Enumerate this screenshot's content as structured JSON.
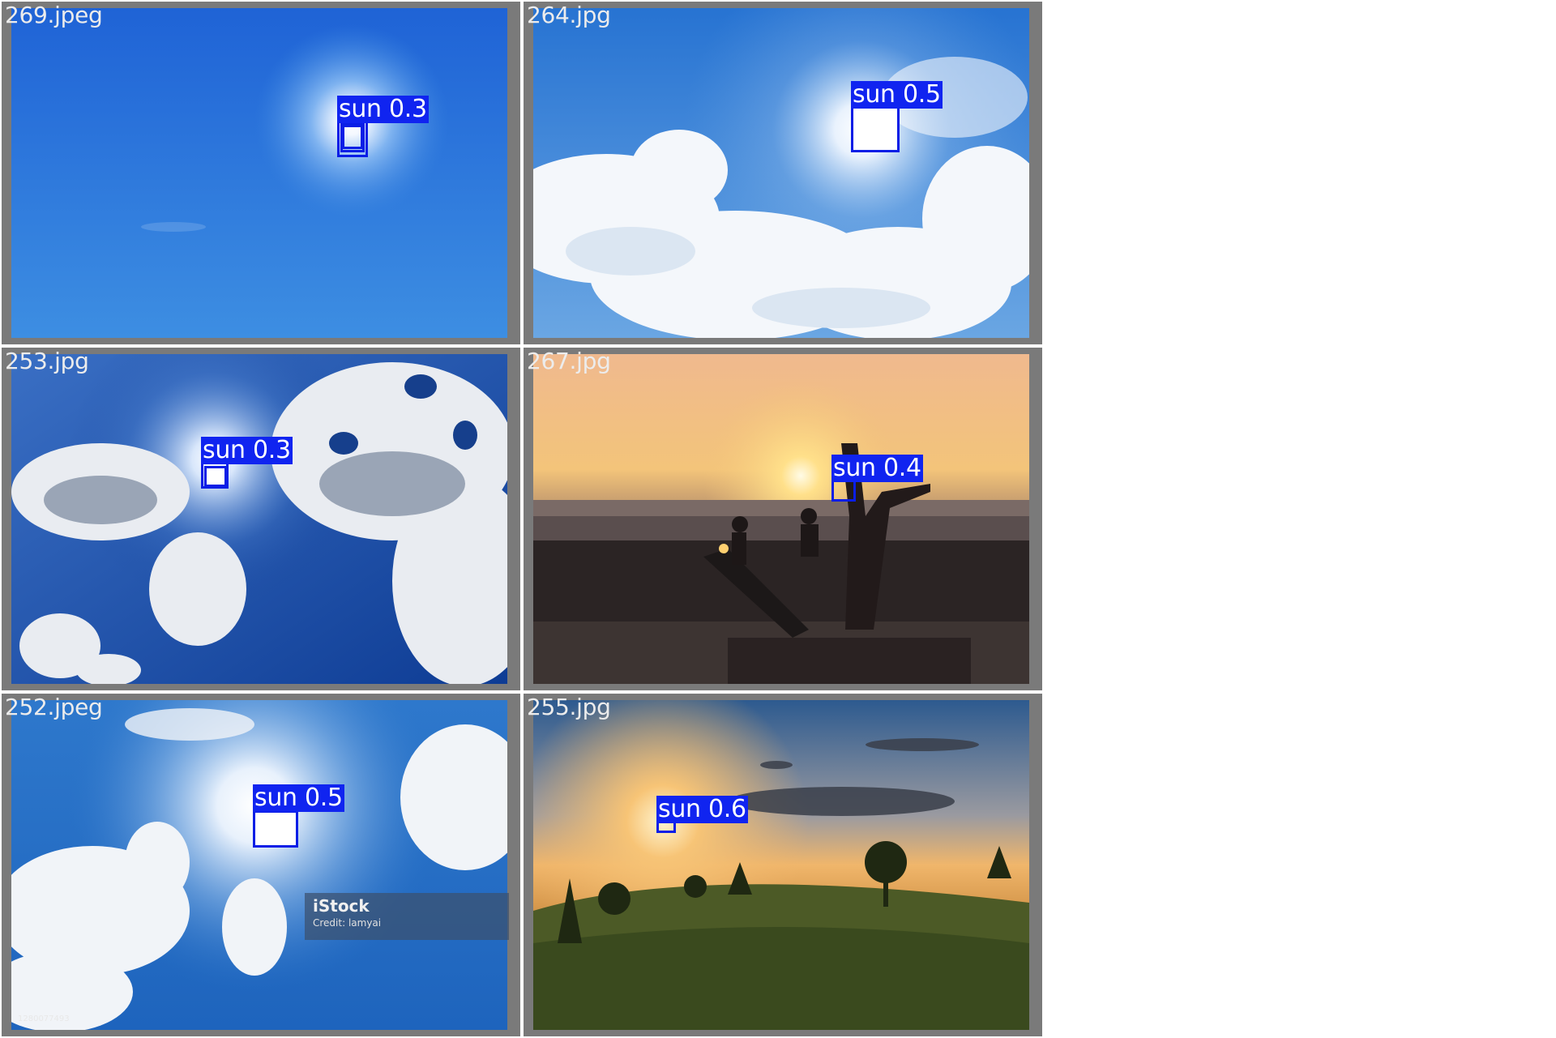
{
  "grid": {
    "tiles": [
      {
        "filename": "269.jpeg",
        "detection": {
          "class": "sun",
          "score": "0.3",
          "label": "sun 0.3"
        }
      },
      {
        "filename": "264.jpg",
        "detection": {
          "class": "sun",
          "score": "0.5",
          "label": "sun 0.5"
        }
      },
      {
        "filename": "253.jpg",
        "detection": {
          "class": "sun",
          "score": "0.3",
          "label": "sun 0.3"
        }
      },
      {
        "filename": "267.jpg",
        "detection": {
          "class": "sun",
          "score": "0.4",
          "label": "sun 0.4"
        }
      },
      {
        "filename": "252.jpeg",
        "detection": {
          "class": "sun",
          "score": "0.5",
          "label": "sun 0.5"
        },
        "watermark": {
          "brand": "iStock",
          "credit": "Credit: lamyai",
          "id": "1280077493"
        }
      },
      {
        "filename": "255.jpg",
        "detection": {
          "class": "sun",
          "score": "0.6",
          "label": "sun 0.6"
        }
      }
    ]
  },
  "colors": {
    "frame": "#7a7a7a",
    "box_stroke": "#0a1ee6",
    "label_bg": "#1024f0",
    "label_text": "#ffffff",
    "filename_text": "#ececec"
  }
}
